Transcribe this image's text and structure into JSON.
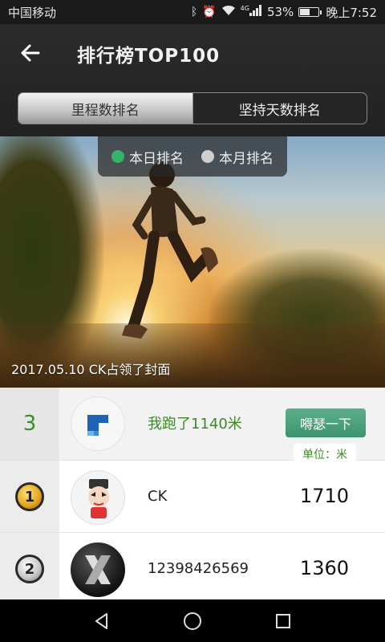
{
  "status_bar": {
    "carrier": "中国移动",
    "signal_tag": "4G",
    "battery": "53%",
    "battery_level": 0.53,
    "time": "晚上7:52"
  },
  "header": {
    "title": "排行榜TOP100",
    "tabs": [
      {
        "label": "里程数排名",
        "active": true
      },
      {
        "label": "坚持天数排名",
        "active": false
      }
    ]
  },
  "hero": {
    "period_options": [
      {
        "label": "本日排名",
        "selected": true
      },
      {
        "label": "本月排名",
        "selected": false
      }
    ],
    "caption": "2017.05.10  CK占领了封面"
  },
  "my_rank": {
    "rank": "3",
    "text": "我跑了1140米",
    "cheer_label": "嘚瑟一下",
    "unit_label": "单位：米"
  },
  "rankings": [
    {
      "medal": "1",
      "name": "CK",
      "value": "1710"
    },
    {
      "medal": "2",
      "name": "12398426569",
      "value": "1360"
    }
  ],
  "colors": {
    "accent_green": "#3e8a2a",
    "button_green": "#4ea37c",
    "radio_on": "#35b36a"
  }
}
